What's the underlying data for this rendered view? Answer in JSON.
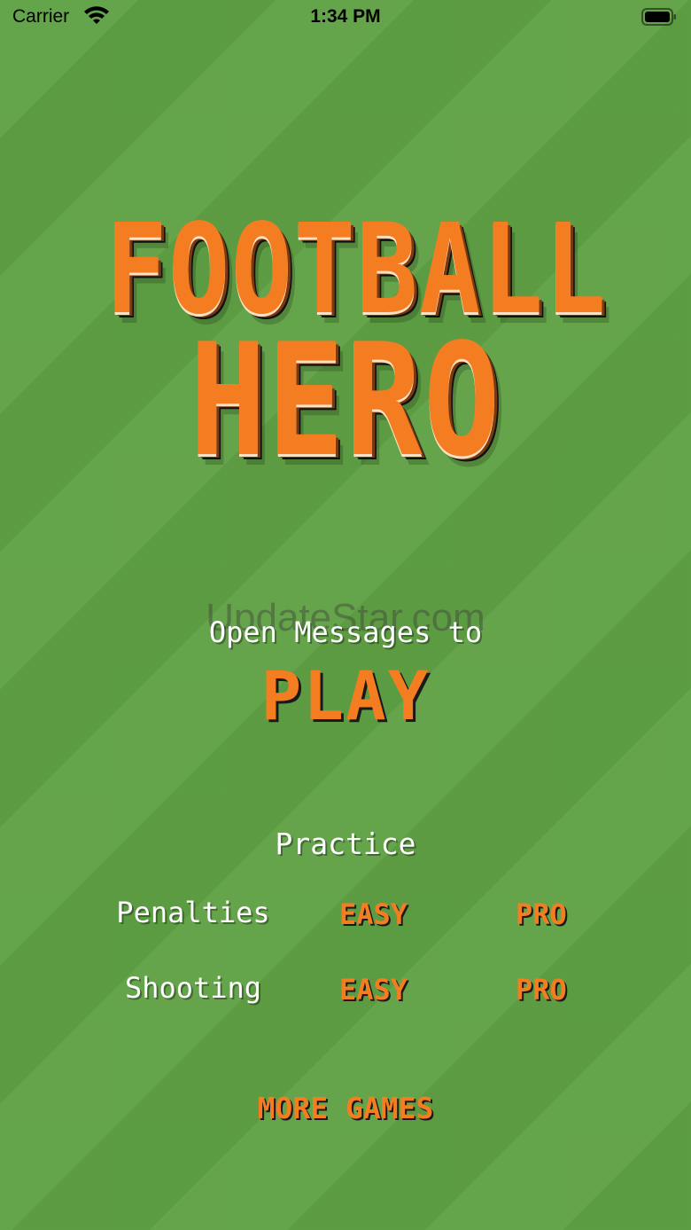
{
  "status_bar": {
    "carrier": "Carrier",
    "time": "1:34 PM"
  },
  "logo": {
    "line1": "FOOTBALL",
    "line2": "HERO"
  },
  "watermark": "UpdateStar.com",
  "main": {
    "open_messages": "Open Messages to",
    "play": "PLAY"
  },
  "practice": {
    "title": "Practice",
    "rows": [
      {
        "label": "Penalties",
        "easy": "EASY",
        "pro": "PRO"
      },
      {
        "label": "Shooting",
        "easy": "EASY",
        "pro": "PRO"
      }
    ]
  },
  "more_games": "MORE GAMES",
  "colors": {
    "background": "#5fa144",
    "accent": "#f47d21",
    "text": "#ffffff"
  }
}
